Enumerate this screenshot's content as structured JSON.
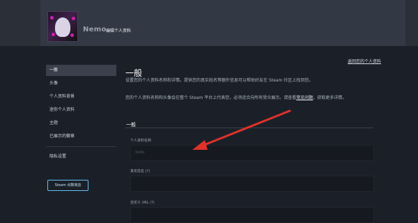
{
  "header": {
    "username": "Nemo",
    "title": "编辑个人资料"
  },
  "return_link": "返回您的个人资料",
  "sidebar": {
    "items": [
      {
        "label": "一般",
        "active": true
      },
      {
        "label": "头像"
      },
      {
        "label": "个人资料背景"
      },
      {
        "label": "迷你个人资料"
      },
      {
        "label": "主题"
      },
      {
        "label": "已展示的徽章"
      },
      {
        "label": "隐私设置"
      }
    ],
    "point_shop_button": "Steam 点数商店"
  },
  "main": {
    "title": "一般",
    "description1": "设置您的个人资料名称和详情。提供您的真实姓名等额外信息可以帮助好友在 Steam 社区上找到您。",
    "description2_prefix": "您的个人资料名称和头像会在整个 Steam 平台上代表您，必须适合向所有受众展示。请查看",
    "faq_link": "常见问题",
    "description2_suffix": "，获取更多详情。",
    "section_title": "一般",
    "fields": [
      {
        "label": "个人资料名称",
        "value": "NeNe"
      },
      {
        "label": "真实姓名 (?)",
        "value": ""
      },
      {
        "label": "自定义 URL (?)",
        "value": ""
      }
    ]
  },
  "colors": {
    "background": "#1b2028",
    "header": "#323844",
    "accent_blue": "#67c1f5",
    "arrow_red": "#e0312b"
  }
}
